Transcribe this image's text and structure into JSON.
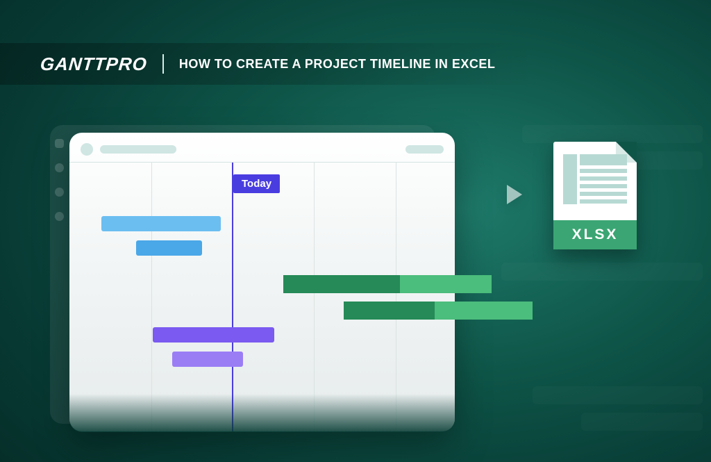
{
  "header": {
    "logo": "GANTTPRO",
    "title": "HOW TO CREATE A PROJECT TIMELINE IN EXCEL"
  },
  "gantt": {
    "today_label": "Today"
  },
  "file": {
    "extension_label": "XLSX"
  }
}
